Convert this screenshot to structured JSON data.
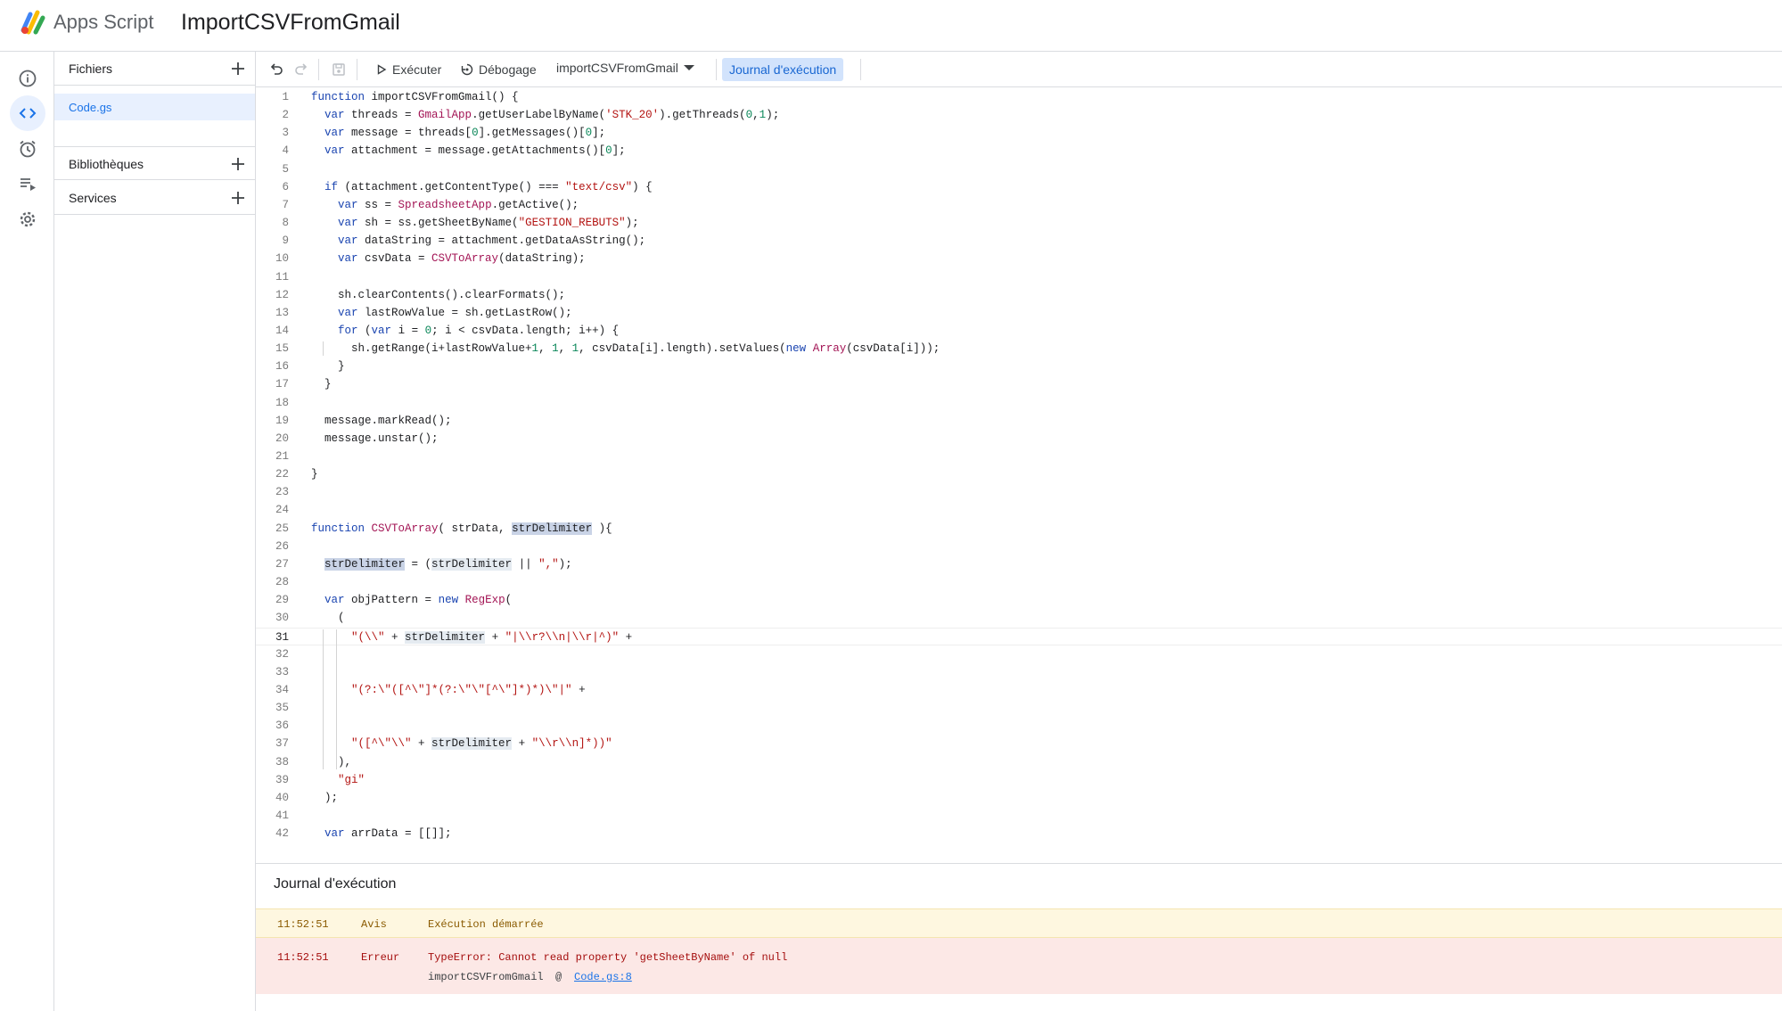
{
  "header": {
    "app_name": "Apps Script",
    "project_title": "ImportCSVFromGmail"
  },
  "rail": {
    "items": [
      "info-icon",
      "code-icon",
      "clock-icon",
      "executions-icon",
      "settings-icon"
    ],
    "active": "code-icon"
  },
  "files_panel": {
    "files_label": "Fichiers",
    "file_name": "Code.gs",
    "libraries_label": "Bibliothèques",
    "services_label": "Services"
  },
  "toolbar": {
    "run_label": "Exécuter",
    "debug_label": "Débogage",
    "function_name": "importCSVFromGmail",
    "log_label": "Journal d'exécution"
  },
  "editor": {
    "current_line": 31,
    "lines": [
      "function importCSVFromGmail() {",
      "  var threads = GmailApp.getUserLabelByName('STK_20').getThreads(0,1);",
      "  var message = threads[0].getMessages()[0];",
      "  var attachment = message.getAttachments()[0];",
      "",
      "  if (attachment.getContentType() === \"text/csv\") {",
      "    var ss = SpreadsheetApp.getActive();",
      "    var sh = ss.getSheetByName(\"GESTION_REBUTS\");",
      "    var dataString = attachment.getDataAsString();",
      "    var csvData = CSVToArray(dataString);",
      "",
      "    sh.clearContents().clearFormats();",
      "    var lastRowValue = sh.getLastRow();",
      "    for (var i = 0; i < csvData.length; i++) {",
      "      sh.getRange(i+lastRowValue+1, 1, 1, csvData[i].length).setValues(new Array(csvData[i]));",
      "    }",
      "  }",
      "",
      "  message.markRead();",
      "  message.unstar();",
      "",
      "}",
      "",
      "",
      "function CSVToArray( strData, strDelimiter ){",
      "",
      "  strDelimiter = (strDelimiter || \",\");",
      "",
      "  var objPattern = new RegExp(",
      "    (",
      "      \"(\\\\\" + strDelimiter + \"|\\\\r?\\\\n|\\\\r|^)\" +",
      "",
      "",
      "      \"(?:\\\"([^\\\"]*(?:\\\"\\\"[^\\\"]*)*)\\\"|\" +",
      "",
      "",
      "      \"([^\\\"\\\\\" + strDelimiter + \"\\\\r\\\\n]*))\"",
      "    ),",
      "    \"gi\"",
      "  );",
      "",
      "  var arrData = [[]];"
    ]
  },
  "log_panel": {
    "title": "Journal d'exécution",
    "entries": [
      {
        "time": "11:52:51",
        "level": "Avis",
        "message": "Exécution démarrée"
      },
      {
        "time": "11:52:51",
        "level": "Erreur",
        "message": "TypeError: Cannot read property 'getSheetByName' of null",
        "trace_fn": "importCSVFromGmail",
        "trace_at": "@",
        "trace_link": "Code.gs:8"
      }
    ]
  }
}
